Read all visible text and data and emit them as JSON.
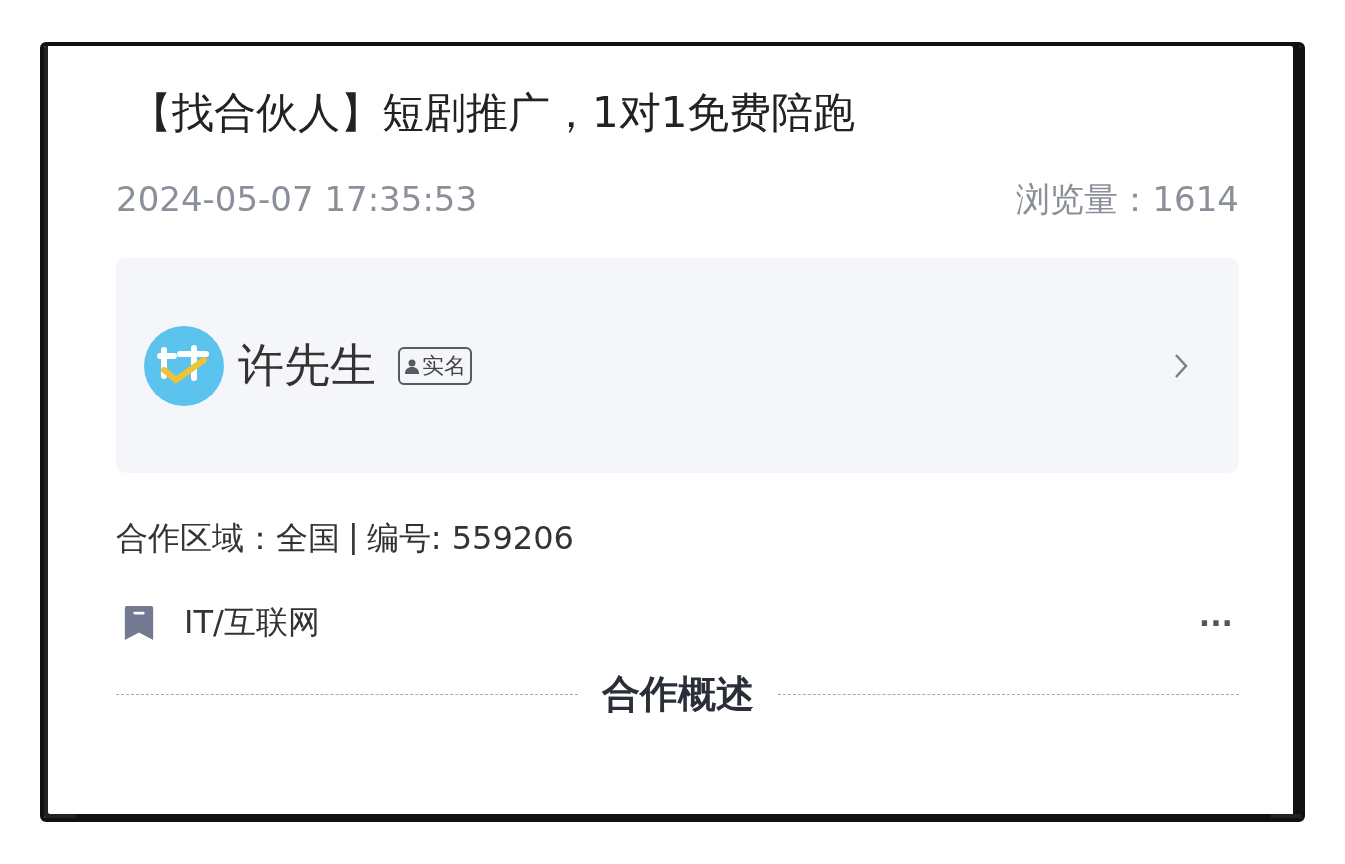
{
  "title": "【找合伙人】短剧推广，1对1免费陪跑",
  "meta": {
    "date": "2024-05-07 17:35:53",
    "views": "浏览量：1614"
  },
  "publisher": {
    "name": "许先生",
    "badge": "实名",
    "verified": true
  },
  "info": {
    "region": "合作区域：全国",
    "separator": "|",
    "number": "编号: 559206"
  },
  "category": {
    "label": "IT/互联网",
    "more": "···"
  },
  "section": {
    "heading": "合作概述"
  }
}
